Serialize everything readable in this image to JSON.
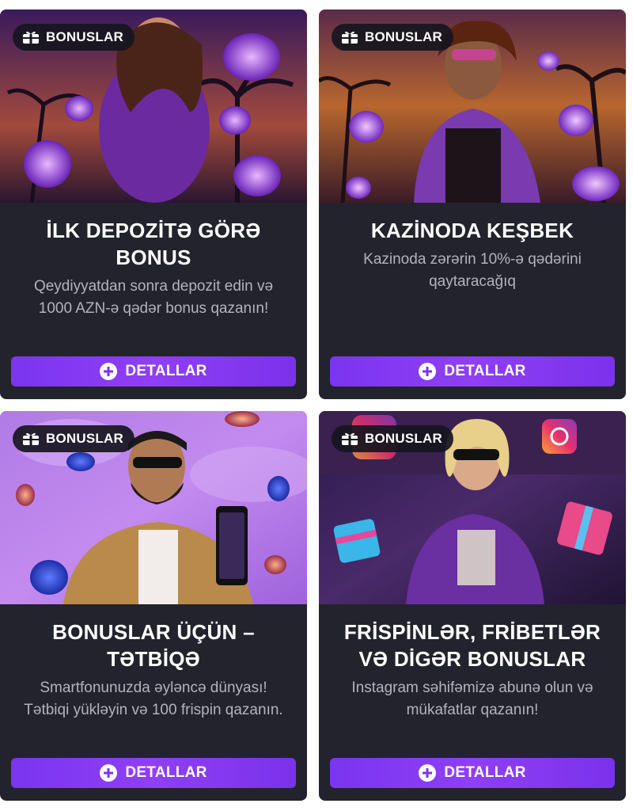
{
  "cards": [
    {
      "badge": "BONUSLAR",
      "badge_icon": "gift-icon",
      "title": "İLK DEPOZİTƏ GÖRƏ BONUS",
      "description": "Qeydiyyatdan sonra depozit edin və 1000 AZN-ə qədər bonus qazanın!",
      "button": "DETALLAR"
    },
    {
      "badge": "BONUSLAR",
      "badge_icon": "gift-icon",
      "title": "KAZİNODA KEŞBEK",
      "description": "Kazinoda zərərin 10%-ə qədərini qaytaracağıq",
      "button": "DETALLAR"
    },
    {
      "badge": "BONUSLAR",
      "badge_icon": "gift-icon",
      "title": "BONUSLAR ÜÇÜN – TƏTBİQƏ",
      "description": "Smartfonunuzda əyləncə dünyası! Tətbiqi yükləyin və 100 frispin qazanın.",
      "button": "DETALLAR"
    },
    {
      "badge": "BONUSLAR",
      "badge_icon": "gift-icon",
      "title": "FRİSPİNLƏR, FRİBETLƏR VƏ DİGƏR BONUSLAR",
      "description": "Instagram səhifəmizə abunə olun və mükafatlar qazanın!",
      "button": "DETALLAR"
    }
  ],
  "colors": {
    "card_background": "#23232d",
    "button_accent": "#7b35f0",
    "title_text": "#ffffff",
    "description_text": "#b3b3bf"
  }
}
